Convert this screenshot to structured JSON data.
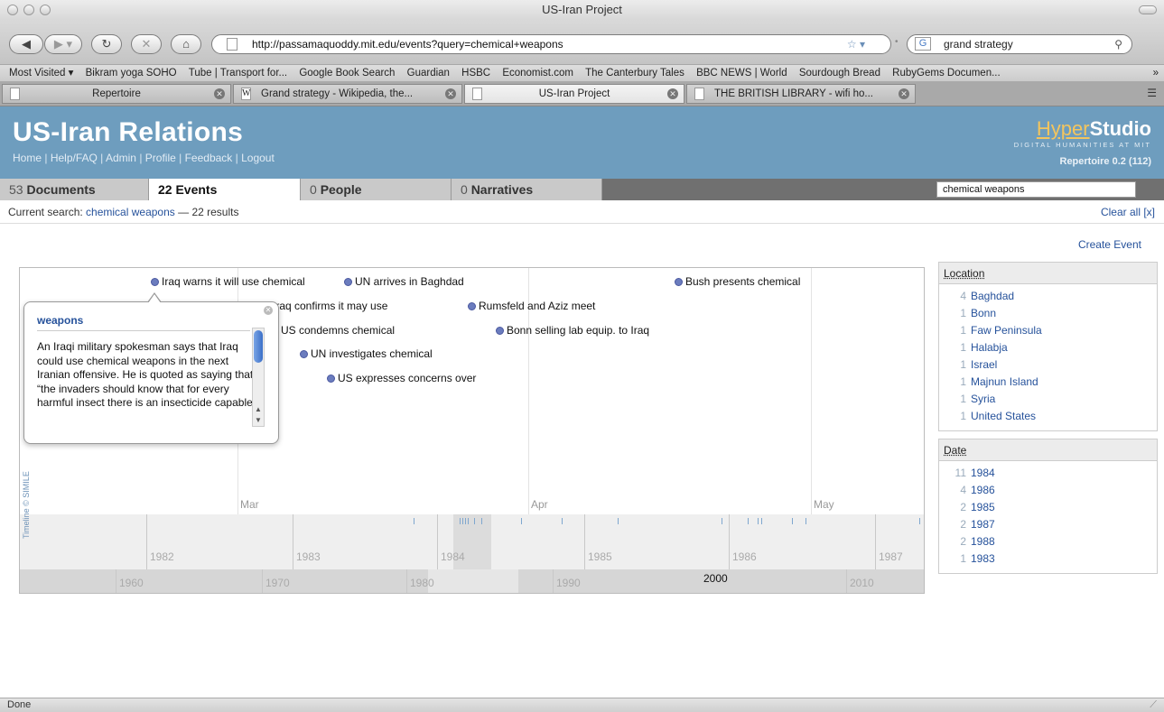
{
  "window": {
    "title": "US-Iran Project"
  },
  "nav": {
    "url": "http://passamaquoddy.mit.edu/events?query=chemical+weapons",
    "search_value": "grand strategy"
  },
  "bookmarks": [
    "Most Visited ▾",
    "Bikram yoga SOHO",
    "Tube | Transport for...",
    "Google Book Search",
    "Guardian",
    "HSBC",
    "Economist.com",
    "The Canterbury Tales",
    "BBC NEWS | World",
    "Sourdough Bread",
    "RubyGems Documen..."
  ],
  "browser_tabs": [
    {
      "label": "Repertoire"
    },
    {
      "label": "Grand strategy - Wikipedia, the..."
    },
    {
      "label": "US-Iran Project"
    },
    {
      "label": "THE BRITISH LIBRARY - wifi ho..."
    }
  ],
  "header": {
    "title": "US-Iran Relations",
    "nav": [
      "Home",
      "Help/FAQ",
      "Admin",
      "Profile",
      "Feedback",
      "Logout"
    ],
    "logo_hyper": "Hyper",
    "logo_studio": "Studio",
    "logo_sub": "DIGITAL HUMANITIES AT MIT",
    "version": "Repertoire 0.2 (112)"
  },
  "section_tabs": [
    {
      "count": "53",
      "label": "Documents"
    },
    {
      "count": "22",
      "label": "Events"
    },
    {
      "count": "0",
      "label": "People"
    },
    {
      "count": "0",
      "label": "Narratives"
    }
  ],
  "search": {
    "value": "chemical weapons"
  },
  "current_search": {
    "label": "Current search:",
    "query": "chemical weapons",
    "results": "— 22 results",
    "clear": "Clear all [x]"
  },
  "create_event": "Create Event",
  "timeline": {
    "months": [
      "Mar",
      "Apr",
      "May"
    ],
    "events": [
      "Iraq warns it will use chemical",
      "UN arrives in Baghdad",
      "Bush presents chemical",
      "Iraq confirms it may use",
      "Rumsfeld and Aziz meet",
      "US condemns chemical",
      "Bonn selling lab equip. to Iraq",
      "UN investigates chemical",
      "US expresses concerns over"
    ],
    "years": [
      "1982",
      "1983",
      "1984",
      "1985",
      "1986",
      "1987"
    ],
    "decades": [
      "1960",
      "1970",
      "1980",
      "1990",
      "2000",
      "2010"
    ],
    "credit": "Timeline © SIMILE"
  },
  "popup": {
    "title": "weapons",
    "body": "An Iraqi military spokesman says that Iraq could use chemical weapons in the next Iranian offensive. He is quoted as saying that “the invaders should know that for every harmful insect there is an insecticide capable"
  },
  "facets": {
    "location": {
      "title": "Location",
      "items": [
        {
          "count": "4",
          "label": "Baghdad"
        },
        {
          "count": "1",
          "label": "Bonn"
        },
        {
          "count": "1",
          "label": "Faw Peninsula"
        },
        {
          "count": "1",
          "label": "Halabja"
        },
        {
          "count": "1",
          "label": "Israel"
        },
        {
          "count": "1",
          "label": "Majnun Island"
        },
        {
          "count": "1",
          "label": "Syria"
        },
        {
          "count": "1",
          "label": "United States"
        }
      ]
    },
    "date": {
      "title": "Date",
      "items": [
        {
          "count": "11",
          "label": "1984"
        },
        {
          "count": "4",
          "label": "1986"
        },
        {
          "count": "2",
          "label": "1985"
        },
        {
          "count": "2",
          "label": "1987"
        },
        {
          "count": "2",
          "label": "1988"
        },
        {
          "count": "1",
          "label": "1983"
        }
      ]
    }
  },
  "status": "Done"
}
